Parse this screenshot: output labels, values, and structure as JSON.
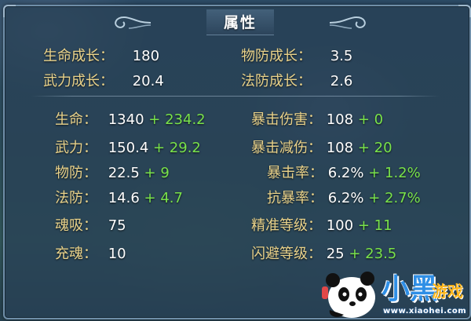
{
  "title": "属性",
  "growth": [
    {
      "label": "生命成长：",
      "value": "180"
    },
    {
      "label": "武力成长：",
      "value": "20.4"
    },
    {
      "label": "物防成长：",
      "value": "3.5"
    },
    {
      "label": "法防成长：",
      "value": "2.6"
    }
  ],
  "left_stats": [
    {
      "label": "生命：",
      "value": "1340",
      "bonus": "+ 234.2"
    },
    {
      "label": "武力：",
      "value": "150.4",
      "bonus": "+ 29.2"
    },
    {
      "label": "物防：",
      "value": "22.5",
      "bonus": "+ 9"
    },
    {
      "label": "法防：",
      "value": "14.6",
      "bonus": "+ 4.7"
    },
    {
      "label": "魂吸：",
      "value": "75",
      "bonus": ""
    },
    {
      "label": "充魂：",
      "value": "10",
      "bonus": ""
    }
  ],
  "right_stats": [
    {
      "label": "暴击伤害：",
      "value": "108",
      "bonus": "+ 0"
    },
    {
      "label": "暴击减伤：",
      "value": "108",
      "bonus": "+ 20"
    },
    {
      "label": "暴击率：",
      "value": "6.2%",
      "bonus": "+ 1.2%"
    },
    {
      "label": "抗暴率：",
      "value": "6.2%",
      "bonus": "+ 2.7%"
    },
    {
      "label": "精准等级：",
      "value": "100",
      "bonus": "+ 11"
    },
    {
      "label": "闪避等级：",
      "value": "25",
      "bonus": "+ 23.5"
    }
  ],
  "watermark": {
    "brand": "小黑",
    "suffix": "游戏",
    "url": "www.xiaohei.com"
  },
  "colors": {
    "label": "#e9d28a",
    "value": "#ffffff",
    "bonus": "#79e24a",
    "border": "#6f8ea8"
  }
}
